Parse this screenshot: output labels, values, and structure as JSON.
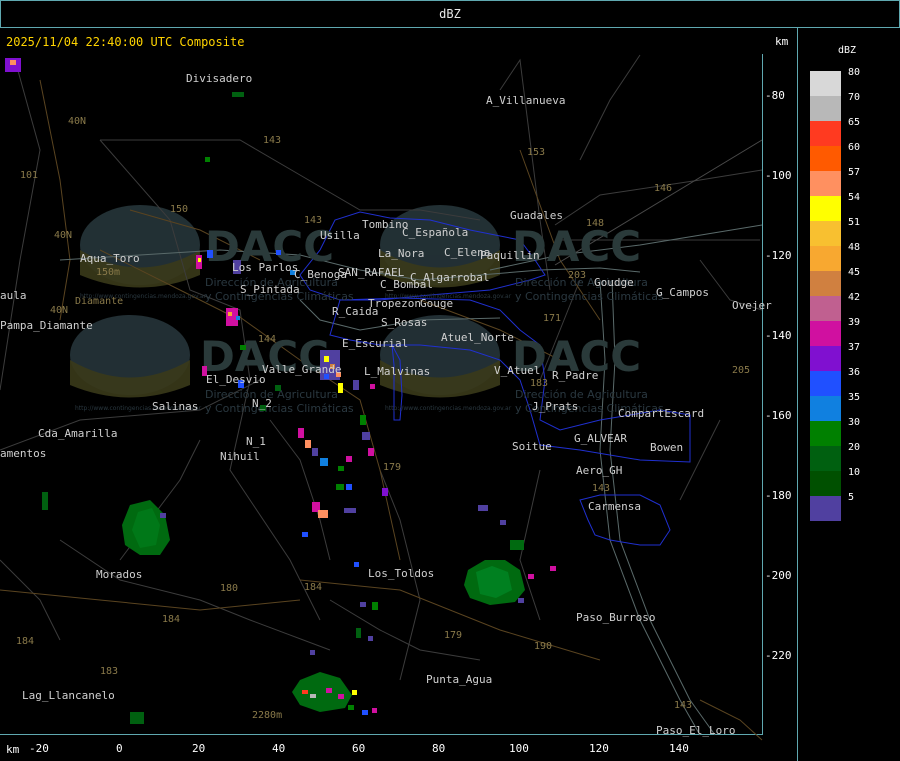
{
  "header": {
    "title": "dBZ"
  },
  "map": {
    "timestamp": "2025/11/04 22:40:00 UTC Composite",
    "km_unit": "km",
    "x_ticks": [
      "-20",
      "0",
      "20",
      "40",
      "60",
      "80",
      "100",
      "120",
      "140"
    ],
    "y_ticks": [
      "-80",
      "-100",
      "-120",
      "-140",
      "-160",
      "-180",
      "-200",
      "-220"
    ],
    "towns": [
      "Divisadero",
      "A_Villanueva",
      "Guadales",
      "Tombino",
      "C_Española",
      "Usilla",
      "La_Nora",
      "C_Elena",
      "Paquillin",
      "Aqua_Toro",
      "Los Parlos",
      "C_Benoga",
      "SAN_RAFAEL",
      "C_Algarrobal",
      "Goudge",
      "C_Bombal",
      "Tropezon",
      "Gouge",
      "G_Campos",
      "Ovejer",
      "Aqua_Toro",
      "aula",
      "Pampa_Diamante",
      "S_Pintada",
      "R_Caida",
      "S_Rosas",
      "Atuel_Norte",
      "E_Escurial",
      "El_Desvio",
      "Valle_Grande",
      "L_Malvinas",
      "V_Atuel",
      "R_Padre",
      "Salinas",
      "N_2",
      "J_Prats",
      "CompartEscard",
      "Cda_Amarilla",
      "N_1",
      "G_ALVEAR",
      "Bowen",
      "Nihuil",
      "Soitue",
      "Aero_GH",
      "amentos",
      "Carmensa",
      "Morados",
      "Los_Toldos",
      "Paso_Burroso",
      "Punta_Agua",
      "Lag_Llancanelo",
      "Paso_El_Loro"
    ],
    "route_labels": [
      "101",
      "40N",
      "143",
      "153",
      "146",
      "150",
      "143",
      "40N",
      "148",
      "150m",
      "Diamante",
      "203",
      "171",
      "144",
      "40N",
      "183",
      "179",
      "184",
      "180",
      "184",
      "179",
      "190",
      "183",
      "184",
      "143",
      "143",
      "205",
      "2280m"
    ],
    "watermark": {
      "brand": "DACC",
      "line1": "Dirección de Agricultura",
      "line2": "y Contingencias Climáticas",
      "url": "http://www.contingencias.mendoza.gov.ar"
    }
  },
  "legend": {
    "title": "dBZ",
    "items": [
      {
        "value": "80",
        "color": "#d8d8d8"
      },
      {
        "value": "70",
        "color": "#b8b8b8"
      },
      {
        "value": "65",
        "color": "#ff3a20"
      },
      {
        "value": "60",
        "color": "#ff5a00"
      },
      {
        "value": "57",
        "color": "#ff9060"
      },
      {
        "value": "54",
        "color": "#ffff00"
      },
      {
        "value": "51",
        "color": "#f8c030"
      },
      {
        "value": "48",
        "color": "#f8a830"
      },
      {
        "value": "45",
        "color": "#d08040"
      },
      {
        "value": "42",
        "color": "#c06090"
      },
      {
        "value": "39",
        "color": "#d010a0"
      },
      {
        "value": "37",
        "color": "#8010d0"
      },
      {
        "value": "36",
        "color": "#2050ff"
      },
      {
        "value": "35",
        "color": "#1080e0"
      },
      {
        "value": "30",
        "color": "#008000"
      },
      {
        "value": "20",
        "color": "#006010"
      },
      {
        "value": "10",
        "color": "#005000"
      },
      {
        "value": "5",
        "color": "#5040a0"
      }
    ]
  }
}
